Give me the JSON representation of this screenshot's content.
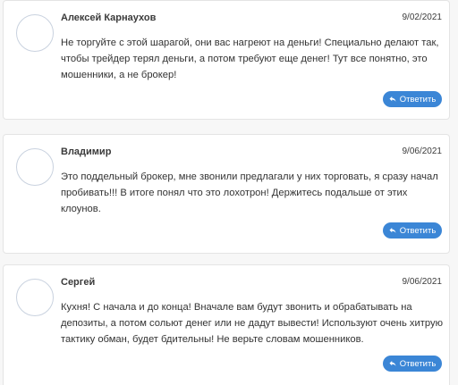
{
  "comments": [
    {
      "author": "Алексей Карнаухов",
      "date": "9/02/2021",
      "text": "Не торгуйте с этой шарагой, они вас нагреют на деньги! Специально делают так, чтобы трейдер терял деньги, а потом требуют еще денег! Тут все понятно, это мошенники, а не брокер!",
      "reply_label": "Ответить"
    },
    {
      "author": "Владимир",
      "date": "9/06/2021",
      "text": "Это поддельный брокер, мне звонили предлагали у них торговать, я сразу начал пробивать!!! В итоге понял что это лохотрон! Держитесь подальше от этих клоунов.",
      "reply_label": "Ответить"
    },
    {
      "author": "Сергей",
      "date": "9/06/2021",
      "text": "Кухня! С начала и до конца! Вначале вам будут звонить и обрабатывать на депозиты, а потом сольют денег или не дадут вывести! Используют очень хитрую тактику обман, будет бдительны! Не верьте словам мошенников.",
      "reply_label": "Ответить"
    }
  ],
  "colors": {
    "reply_button": "#3b86d6",
    "avatar_border": "#c9d2df",
    "card_border": "#e4e4e4",
    "background": "#f7f7f7"
  },
  "icons": {
    "reply": "reply-arrow-icon"
  }
}
